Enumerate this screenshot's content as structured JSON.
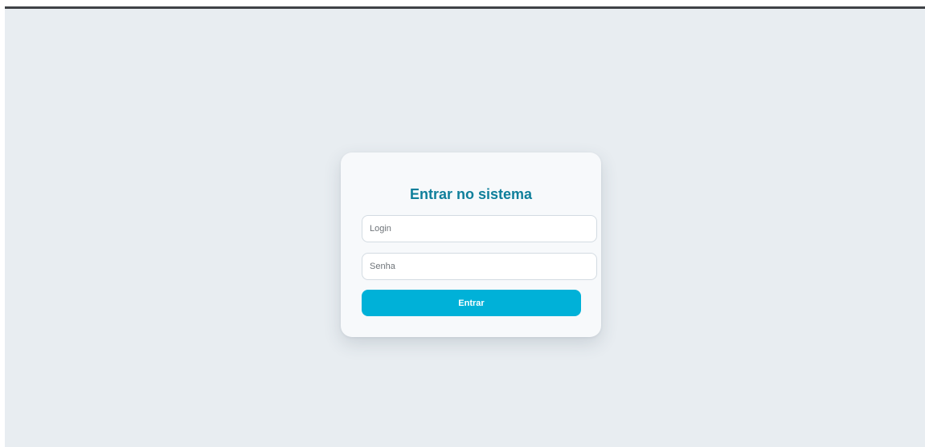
{
  "login_form": {
    "title": "Entrar no sistema",
    "login_placeholder": "Login",
    "password_placeholder": "Senha",
    "submit_label": "Entrar"
  },
  "colors": {
    "background": "#e8edf1",
    "card": "#f7f9fb",
    "title": "#0f7f9b",
    "button": "#00b1d8",
    "top_bar": "#3f4246"
  }
}
